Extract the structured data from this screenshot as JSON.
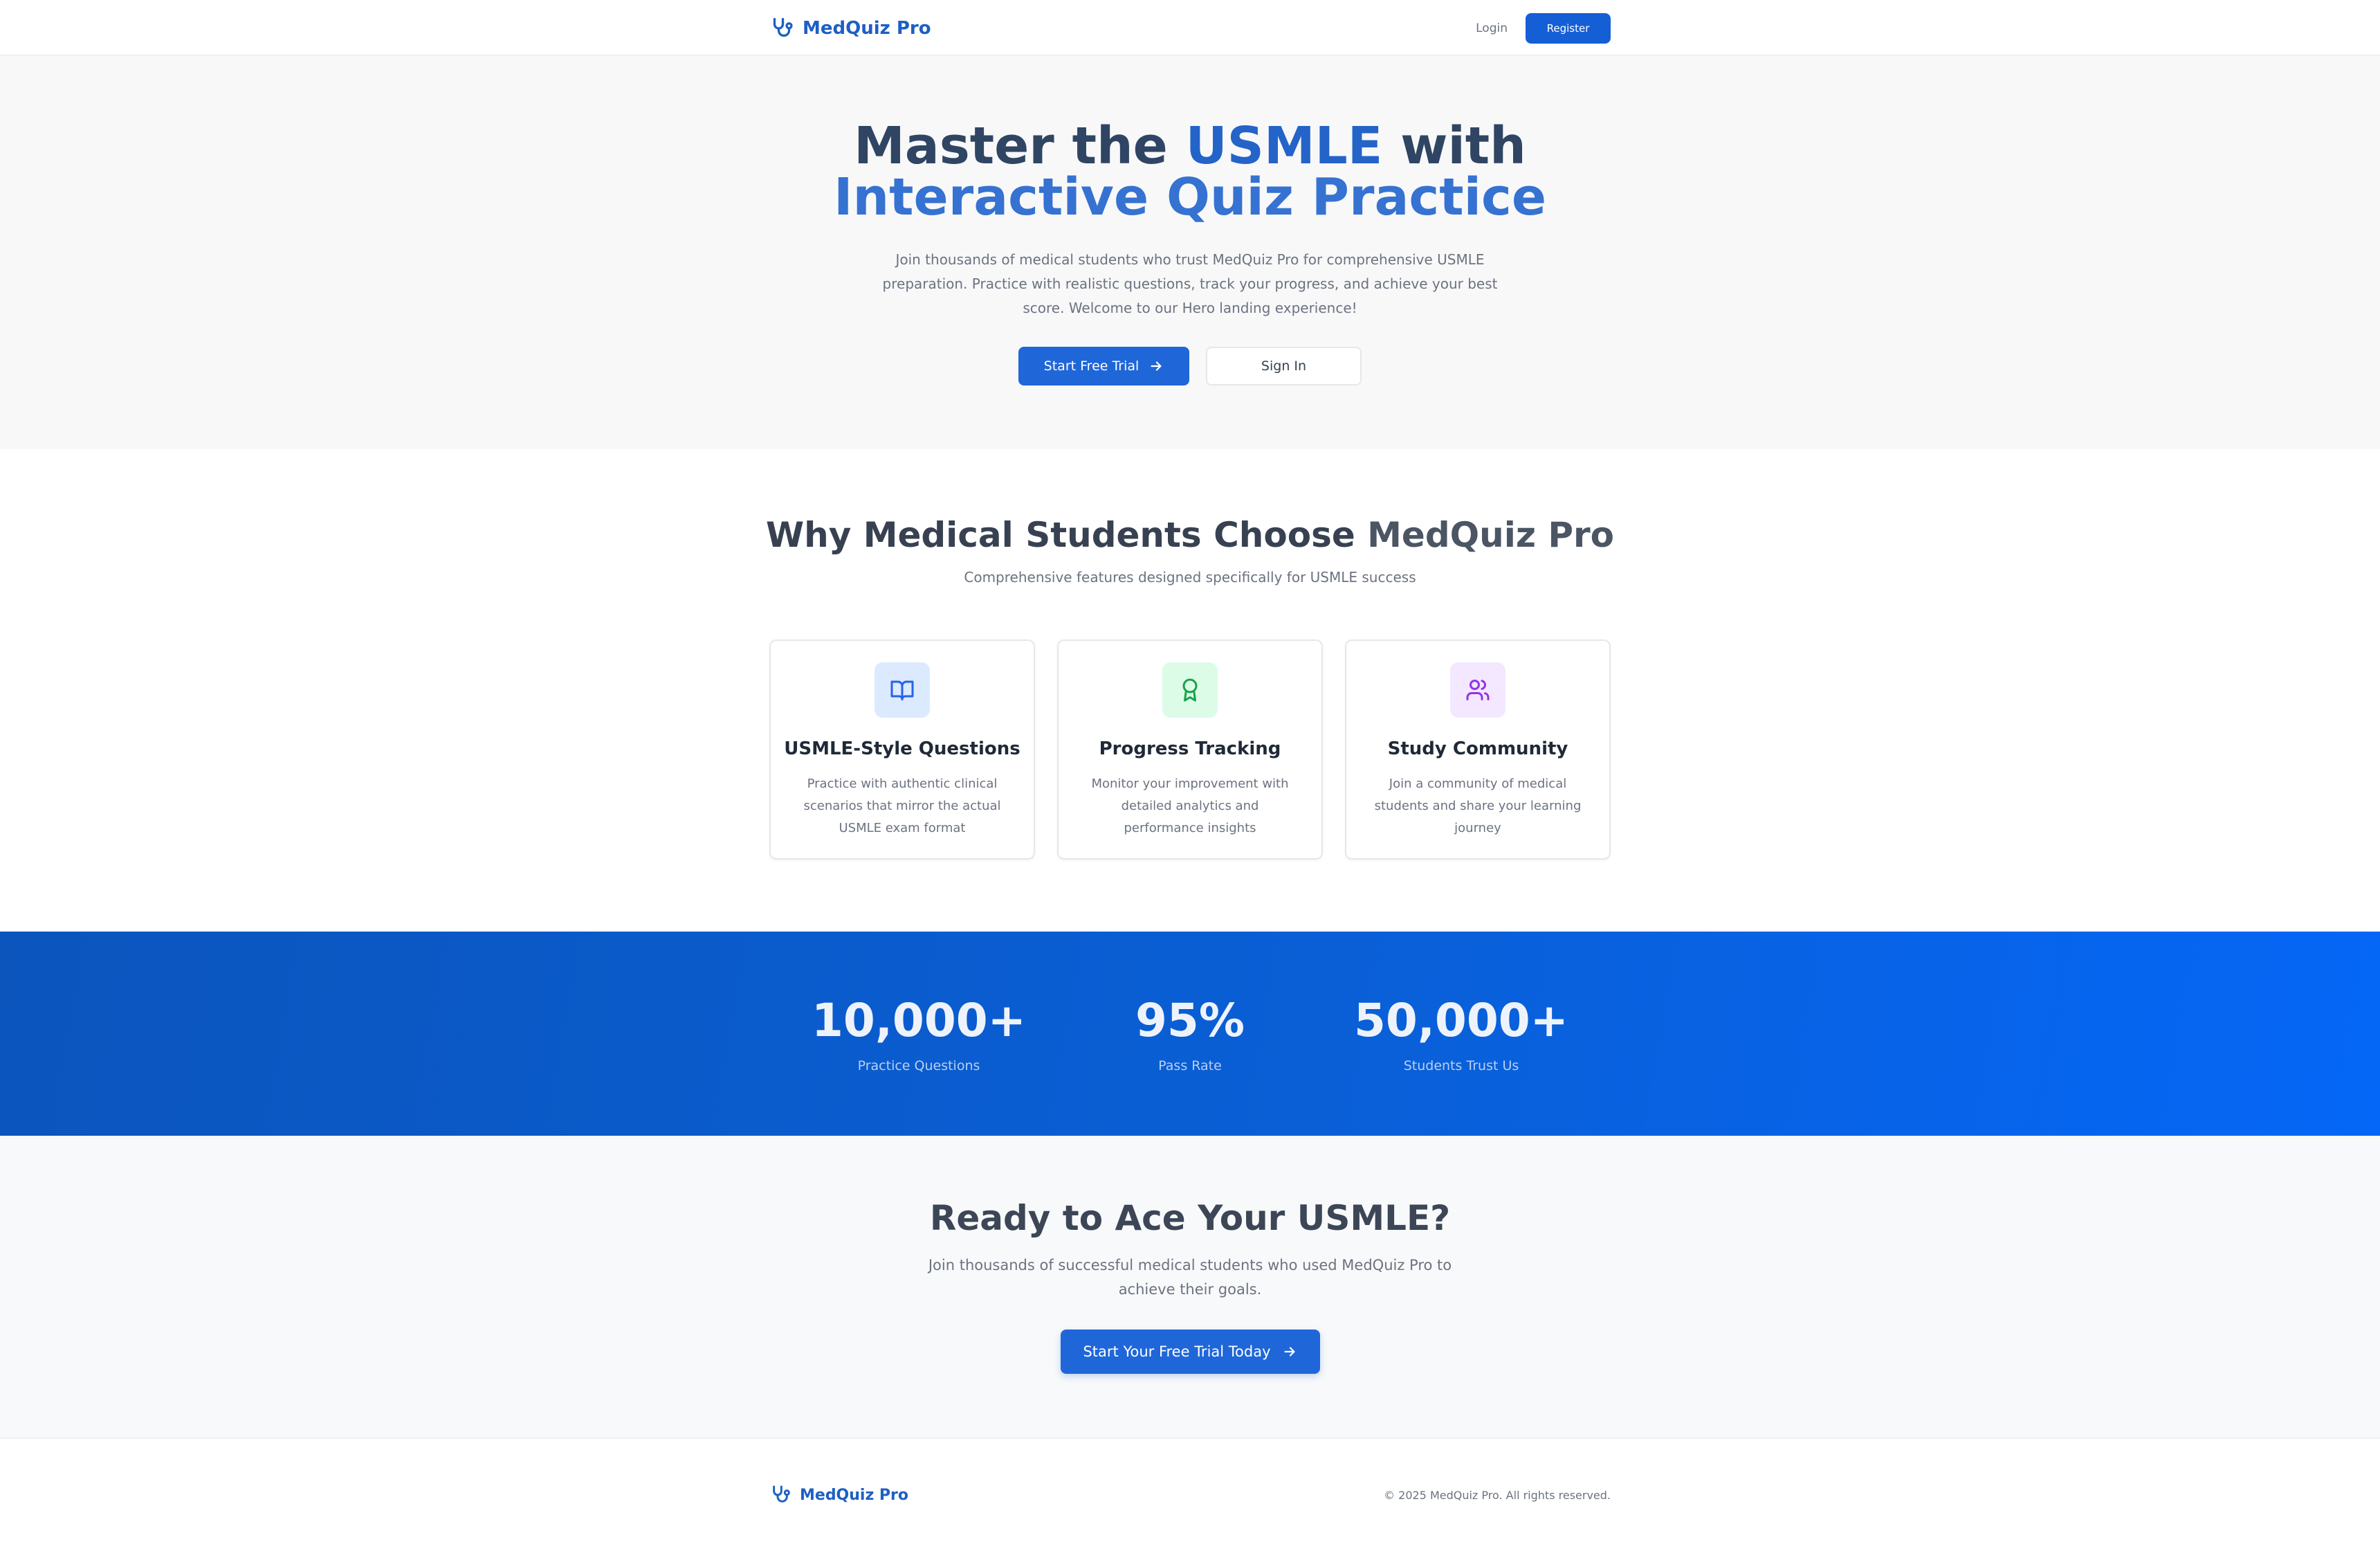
{
  "header": {
    "brand": "MedQuiz Pro",
    "login": "Login",
    "register": "Register"
  },
  "hero": {
    "title_part1": "Master the ",
    "title_highlight": "USMLE",
    "title_part2": " with",
    "title_line2": "Interactive Quiz Practice",
    "description": "Join thousands of medical students who trust MedQuiz Pro for comprehensive USMLE preparation. Practice with realistic questions, track your progress, and achieve your best score. Welcome to our Hero landing experience!",
    "primary_button": "Start Free Trial",
    "secondary_button": "Sign In"
  },
  "features": {
    "title_part1": "Why Medical Students Choose ",
    "title_part2": "MedQuiz Pro",
    "subtitle": "Comprehensive features designed specifically for USMLE success",
    "cards": [
      {
        "icon": "book-open-icon",
        "title": "USMLE-Style Questions",
        "text": "Practice with authentic clinical scenarios that mirror the actual USMLE exam format",
        "color": "#2563eb",
        "bg": "#dbeafe"
      },
      {
        "icon": "award-icon",
        "title": "Progress Tracking",
        "text": "Monitor your improvement with detailed analytics and performance insights",
        "color": "#16a34a",
        "bg": "#dcfce7"
      },
      {
        "icon": "users-icon",
        "title": "Study Community",
        "text": "Join a community of medical students and share your learning journey",
        "color": "#9333ea",
        "bg": "#f3e8ff"
      }
    ]
  },
  "stats": [
    {
      "value": "10,000+",
      "label": "Practice Questions"
    },
    {
      "value": "95%",
      "label": "Pass Rate"
    },
    {
      "value": "50,000+",
      "label": "Students Trust Us"
    }
  ],
  "cta": {
    "title": "Ready to Ace Your USMLE?",
    "description": "Join thousands of successful medical students who used MedQuiz Pro to achieve their goals.",
    "button": "Start Your Free Trial Today"
  },
  "footer": {
    "brand": "MedQuiz Pro",
    "copyright": "© 2025 MedQuiz Pro. All rights reserved."
  },
  "colors": {
    "brand": "#1d5fc4",
    "primary": "#1f66d9",
    "stats_bg_start": "#0b55bd",
    "stats_bg_end": "#0567f7"
  }
}
